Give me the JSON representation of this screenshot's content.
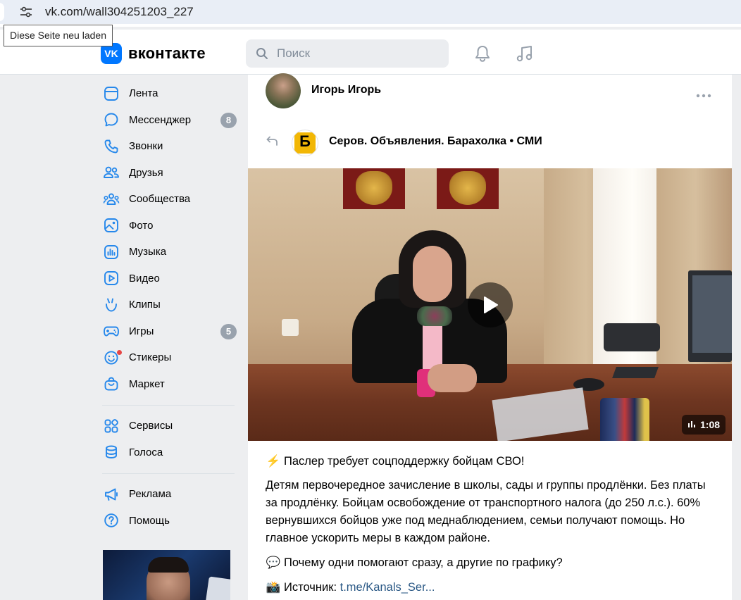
{
  "browser": {
    "url": "vk.com/wall304251203_227",
    "tooltip": "Diese Seite neu laden"
  },
  "header": {
    "logo_text": "вконтакте",
    "logo_badge": "VK",
    "search_placeholder": "Поиск"
  },
  "sidebar": {
    "items": [
      {
        "label": "Лента",
        "icon": "feed-icon"
      },
      {
        "label": "Мессенджер",
        "icon": "message-icon",
        "badge": "8"
      },
      {
        "label": "Звонки",
        "icon": "phone-icon"
      },
      {
        "label": "Друзья",
        "icon": "friends-icon"
      },
      {
        "label": "Сообщества",
        "icon": "communities-icon"
      },
      {
        "label": "Фото",
        "icon": "photo-icon"
      },
      {
        "label": "Музыка",
        "icon": "music-icon"
      },
      {
        "label": "Видео",
        "icon": "video-icon"
      },
      {
        "label": "Клипы",
        "icon": "clips-icon"
      },
      {
        "label": "Игры",
        "icon": "gamepad-icon",
        "badge": "5"
      },
      {
        "label": "Стикеры",
        "icon": "sticker-icon"
      },
      {
        "label": "Маркет",
        "icon": "market-icon"
      },
      {
        "label": "Сервисы",
        "icon": "services-icon"
      },
      {
        "label": "Голоса",
        "icon": "coins-icon"
      },
      {
        "label": "Реклама",
        "icon": "megaphone-icon"
      },
      {
        "label": "Помощь",
        "icon": "help-icon"
      }
    ]
  },
  "post": {
    "author": "Игорь Игорь",
    "source_name": "Серов. Объявления. Барахолка • СМИ",
    "source_avatar_letter": "Б",
    "video_duration": "1:08",
    "text_title": "Паслер требует соцподдержку бойцам СВО!",
    "text_title_emoji": "⚡",
    "text_body": "Детям первочередное зачисление в школы, сады и группы продлёнки. Без платы за продлёнку. Бойцам освобождение от транспортного налога (до 250 л.с.). 60% вернувшихся бойцов уже под меднаблюдением, семьи получают помощь. Но главное ускорить меры в каждом районе.",
    "text_question_emoji": "💬",
    "text_question": "Почему одни помогают сразу, а другие по графику?",
    "text_source_emoji": "📸",
    "text_source_label": "Источник:",
    "text_source_link": "t.me/Kanals_Ser..."
  },
  "colors": {
    "vk_blue": "#0077ff",
    "link": "#2a5885",
    "badge": "#99a2ad",
    "page_bg": "#edeef0"
  }
}
